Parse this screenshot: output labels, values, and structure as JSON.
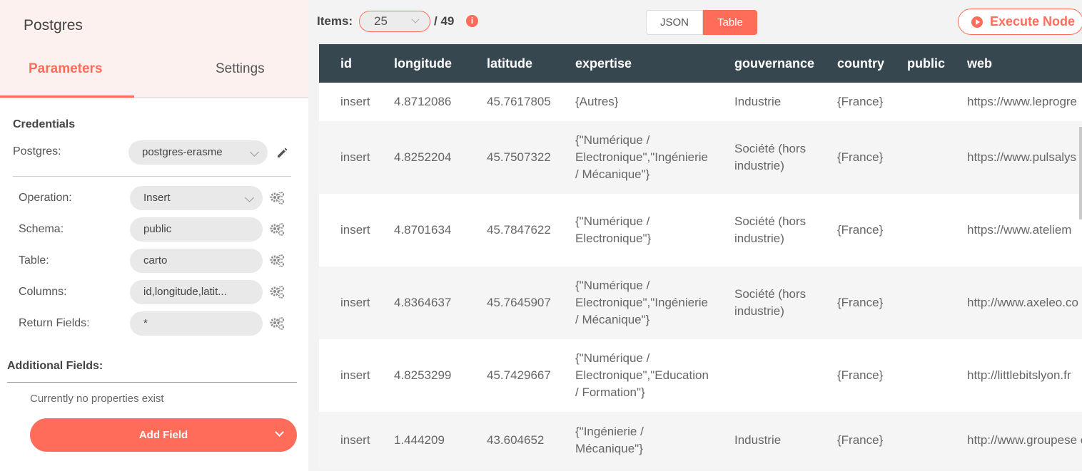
{
  "node": {
    "title": "Postgres"
  },
  "tabs": {
    "parameters": "Parameters",
    "settings": "Settings"
  },
  "credentials": {
    "section_title": "Credentials",
    "postgres_label": "Postgres:",
    "postgres_value": "postgres-erasme"
  },
  "fields": {
    "operation": {
      "label": "Operation:",
      "value": "Insert"
    },
    "schema": {
      "label": "Schema:",
      "value": "public"
    },
    "table": {
      "label": "Table:",
      "value": "carto"
    },
    "columns": {
      "label": "Columns:",
      "value": "id,longitude,latit..."
    },
    "return_fields": {
      "label": "Return Fields:",
      "value": "*"
    }
  },
  "additional": {
    "title": "Additional Fields:",
    "note": "Currently no properties exist",
    "add_button": "Add Field"
  },
  "output": {
    "items_label": "Items:",
    "items_per_page": "25",
    "items_total": "/ 49",
    "info_icon": "i",
    "toggle_json": "JSON",
    "toggle_table": "Table",
    "execute_label": "Execute Node"
  },
  "table": {
    "headers": [
      "id",
      "longitude",
      "latitude",
      "expertise",
      "gouvernance",
      "country",
      "public",
      "web"
    ],
    "rows": [
      [
        "insert",
        "4.8712086",
        "45.7617805",
        "{Autres}",
        "Industrie",
        "{France}",
        "",
        "https://www.leprogre"
      ],
      [
        "insert",
        "4.8252204",
        "45.7507322",
        "{\"Numérique / Electronique\",\"Ingénierie / Mécanique\"}",
        "Société (hors industrie)",
        "{France}",
        "",
        "https://www.pulsalys"
      ],
      [
        "insert",
        "4.8701634",
        "45.7847622",
        "{\"Numérique / Electronique\"}",
        "Société (hors industrie)",
        "{France}",
        "",
        "https://www.ateliem"
      ],
      [
        "insert",
        "4.8364637",
        "45.7645907",
        "{\"Numérique / Electronique\",\"Ingénierie / Mécanique\"}",
        "Société (hors industrie)",
        "{France}",
        "",
        "http://www.axeleo.co"
      ],
      [
        "insert",
        "4.8253299",
        "45.7429667",
        "{\"Numérique / Electronique\",\"Education / Formation\"}",
        "",
        "{France}",
        "",
        "http://littlebitslyon.fr"
      ],
      [
        "insert",
        "1.444209",
        "43.604652",
        "{\"Ingénierie / Mécanique\"}",
        "Industrie",
        "{France}",
        "",
        "http://www.groupese et-enjeux"
      ]
    ]
  },
  "colors": {
    "accent": "#ff6d5a",
    "table_header": "#37474f"
  }
}
